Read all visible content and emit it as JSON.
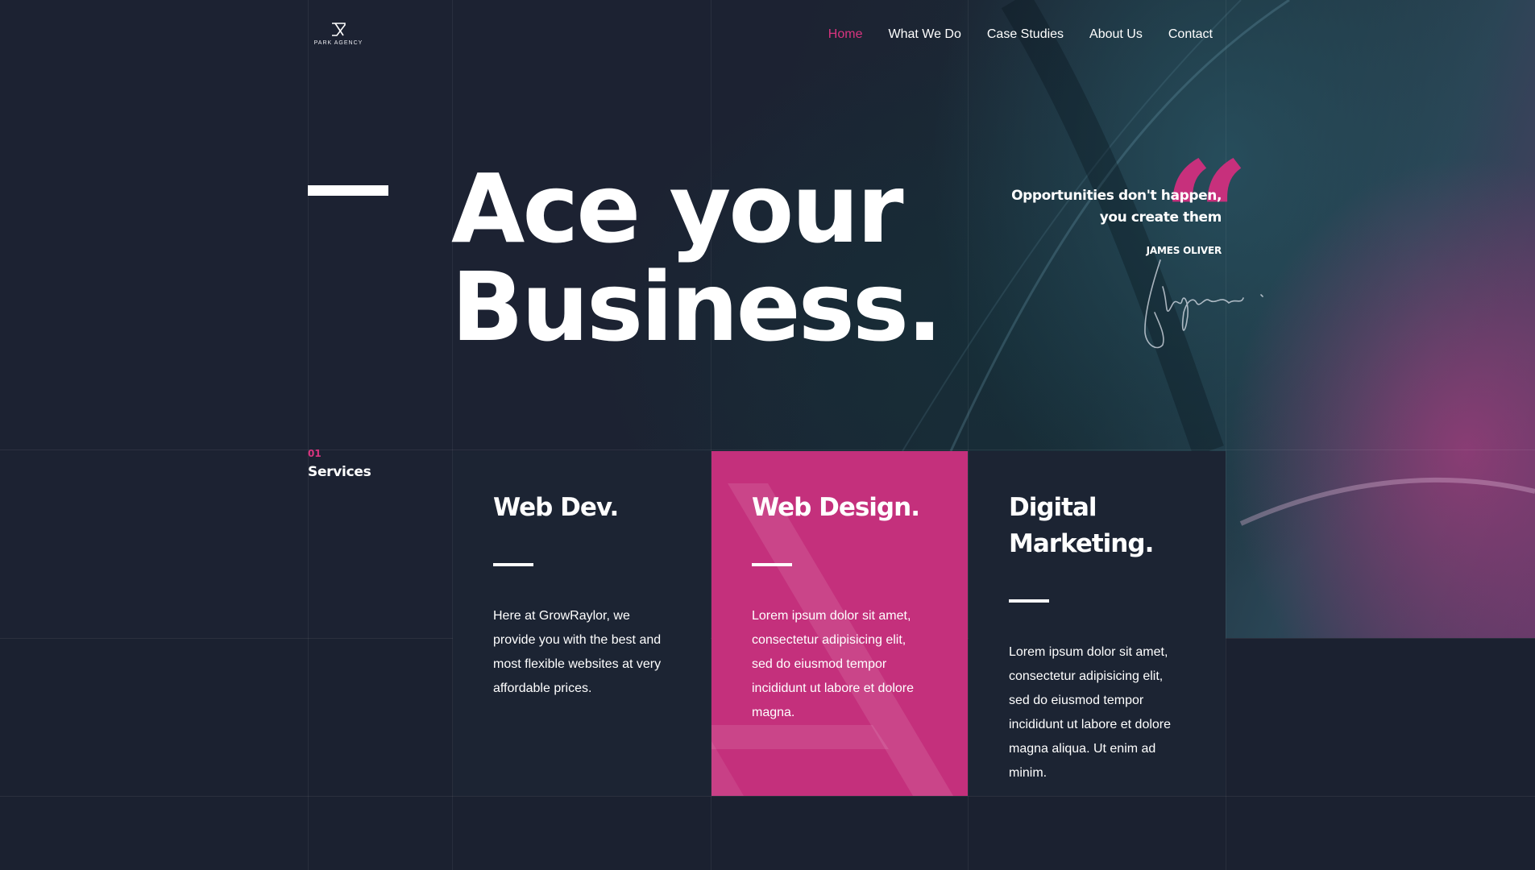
{
  "brand": {
    "logo_text": "PARK AGENCY"
  },
  "nav": {
    "items": [
      {
        "label": "Home",
        "active": true
      },
      {
        "label": "What We Do",
        "active": false
      },
      {
        "label": "Case Studies",
        "active": false
      },
      {
        "label": "About Us",
        "active": false
      },
      {
        "label": "Contact",
        "active": false
      }
    ]
  },
  "hero": {
    "headline_line1": "Ace your",
    "headline_line2": "Business."
  },
  "quote": {
    "line1": "Opportunities don't happen,",
    "line2": "you create them",
    "author": "JAMES OLIVER"
  },
  "services": {
    "number": "01",
    "title": "Services",
    "cards": [
      {
        "title_line1": "Web Dev.",
        "title_line2": "",
        "body": "Here at GrowRaylor, we provide you with the best and most flexible websites at very affordable prices."
      },
      {
        "title_line1": "Web Design.",
        "title_line2": "",
        "body": "Lorem ipsum dolor sit amet, consectetur adipisicing elit, sed do eiusmod tempor incididunt ut labore et dolore magna."
      },
      {
        "title_line1": "Digital",
        "title_line2": "Marketing.",
        "body": "Lorem ipsum dolor sit amet, consectetur adipisicing elit, sed do eiusmod tempor incididunt ut labore et dolore magna aliqua. Ut enim ad minim."
      }
    ]
  },
  "colors": {
    "accent": "#c4307c",
    "nav_active": "#d9347f",
    "background": "#1b2130",
    "card": "#1c2433"
  }
}
